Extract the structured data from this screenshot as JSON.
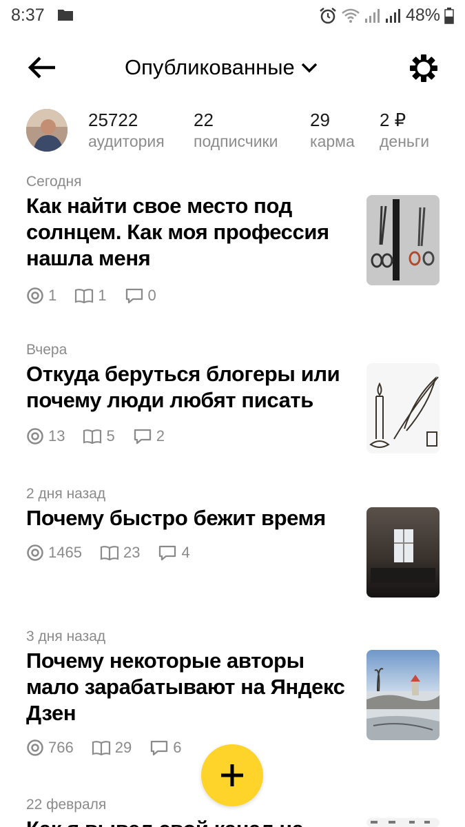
{
  "status_bar": {
    "time": "8:37",
    "battery": "48%",
    "icons": [
      "folder-icon",
      "alarm-icon",
      "wifi-icon",
      "signal-icon",
      "signal-icon",
      "battery-icon"
    ]
  },
  "header": {
    "title": "Опубликованные",
    "back_icon": "arrow-left-icon",
    "settings_icon": "gear-icon",
    "dropdown_icon": "chevron-down-icon"
  },
  "profile": {
    "stats": [
      {
        "value": "25722",
        "label": "аудитория"
      },
      {
        "value": "22",
        "label": "подписчики"
      },
      {
        "value": "29",
        "label": "карма"
      },
      {
        "value": "2 ₽",
        "label": "деньги"
      }
    ]
  },
  "articles": [
    {
      "date": "Сегодня",
      "title": "Как найти свое место под солнцем. Как моя профессия нашла меня",
      "views": "1",
      "reads": "1",
      "comments": "0"
    },
    {
      "date": "Вчера",
      "title": "Откуда беруться блогеры или почему люди любят писать",
      "views": "13",
      "reads": "5",
      "comments": "2"
    },
    {
      "date": "2 дня назад",
      "title": "Почему быстро бежит время",
      "views": "1465",
      "reads": "23",
      "comments": "4"
    },
    {
      "date": "3 дня назад",
      "title": "Почему некоторые авторы мало зарабатывают на Яндекс Дзен",
      "views": "766",
      "reads": "29",
      "comments": "6"
    },
    {
      "date": "22 февраля",
      "title": "Как я вывел свой канал на"
    }
  ],
  "fab": {
    "icon": "plus-icon"
  },
  "colors": {
    "fab": "#fed42b",
    "muted_text": "#8a8a8a"
  }
}
